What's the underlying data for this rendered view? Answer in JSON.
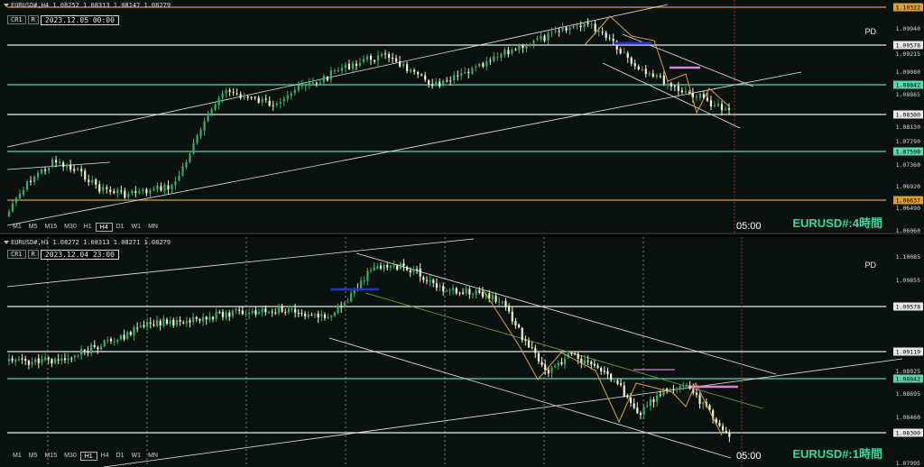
{
  "h4": {
    "header": "EURUSD#,H4  1.08252 1.08313 1.08147 1.08279",
    "btn_cr": "CR1",
    "btn_r": "R",
    "datetime": "2023.12.05 00:00",
    "timeframes": [
      "M1",
      "M5",
      "M15",
      "M30",
      "H1",
      "H4",
      "D1",
      "W1",
      "MN"
    ],
    "active_tf": "H4",
    "pd": "PD",
    "symbol_label": "EURUSD#:4時間",
    "time_marker": "05:00",
    "price_ticks": [
      "1.09940",
      "1.09215",
      "1.09080",
      "1.08865",
      "1.08130",
      "1.07790",
      "1.07360",
      "1.06920",
      "1.06490",
      "1.06060"
    ],
    "price_boxes": [
      {
        "text": "1.10322",
        "color": "#e0a030"
      },
      {
        "text": "1.09578",
        "color": "#e8e8e8"
      },
      {
        "text": "1.08842",
        "color": "#59d6b0"
      },
      {
        "text": "1.08300",
        "color": "#e8e8e8"
      },
      {
        "text": "1.07590",
        "color": "#59d6b0"
      },
      {
        "text": "1.06637",
        "color": "#e0a030"
      }
    ]
  },
  "h1": {
    "header": "EURUSD#,H1  1.08272 1.08313 1.08271 1.08279",
    "btn_cr": "CR1",
    "btn_r": "R",
    "datetime": "2023.12.04 23:00",
    "timeframes": [
      "M1",
      "M5",
      "M15",
      "M30",
      "H1",
      "H4",
      "D1",
      "W1",
      "MN"
    ],
    "active_tf": "H1",
    "pd": "PD",
    "symbol_label": "EURUSD#:1時間",
    "time_marker": "05:00",
    "price_ticks": [
      "1.10085",
      "1.09855",
      "1.08925",
      "1.08695",
      "1.08460",
      "1.07995"
    ],
    "price_boxes": [
      {
        "text": "1.09578",
        "color": "#e8e8e8"
      },
      {
        "text": "1.09119",
        "color": "#e8e8e8"
      },
      {
        "text": "1.08842",
        "color": "#59d6b0"
      },
      {
        "text": "1.08300",
        "color": "#e8e8e8"
      }
    ]
  },
  "colors": {
    "bull": "#33b06a",
    "bear": "#f2f2d0",
    "white_line": "#e8e8e8",
    "aqua_line": "#59d6b0",
    "orange_line": "#e0a030",
    "red_vline": "#d03030"
  }
}
